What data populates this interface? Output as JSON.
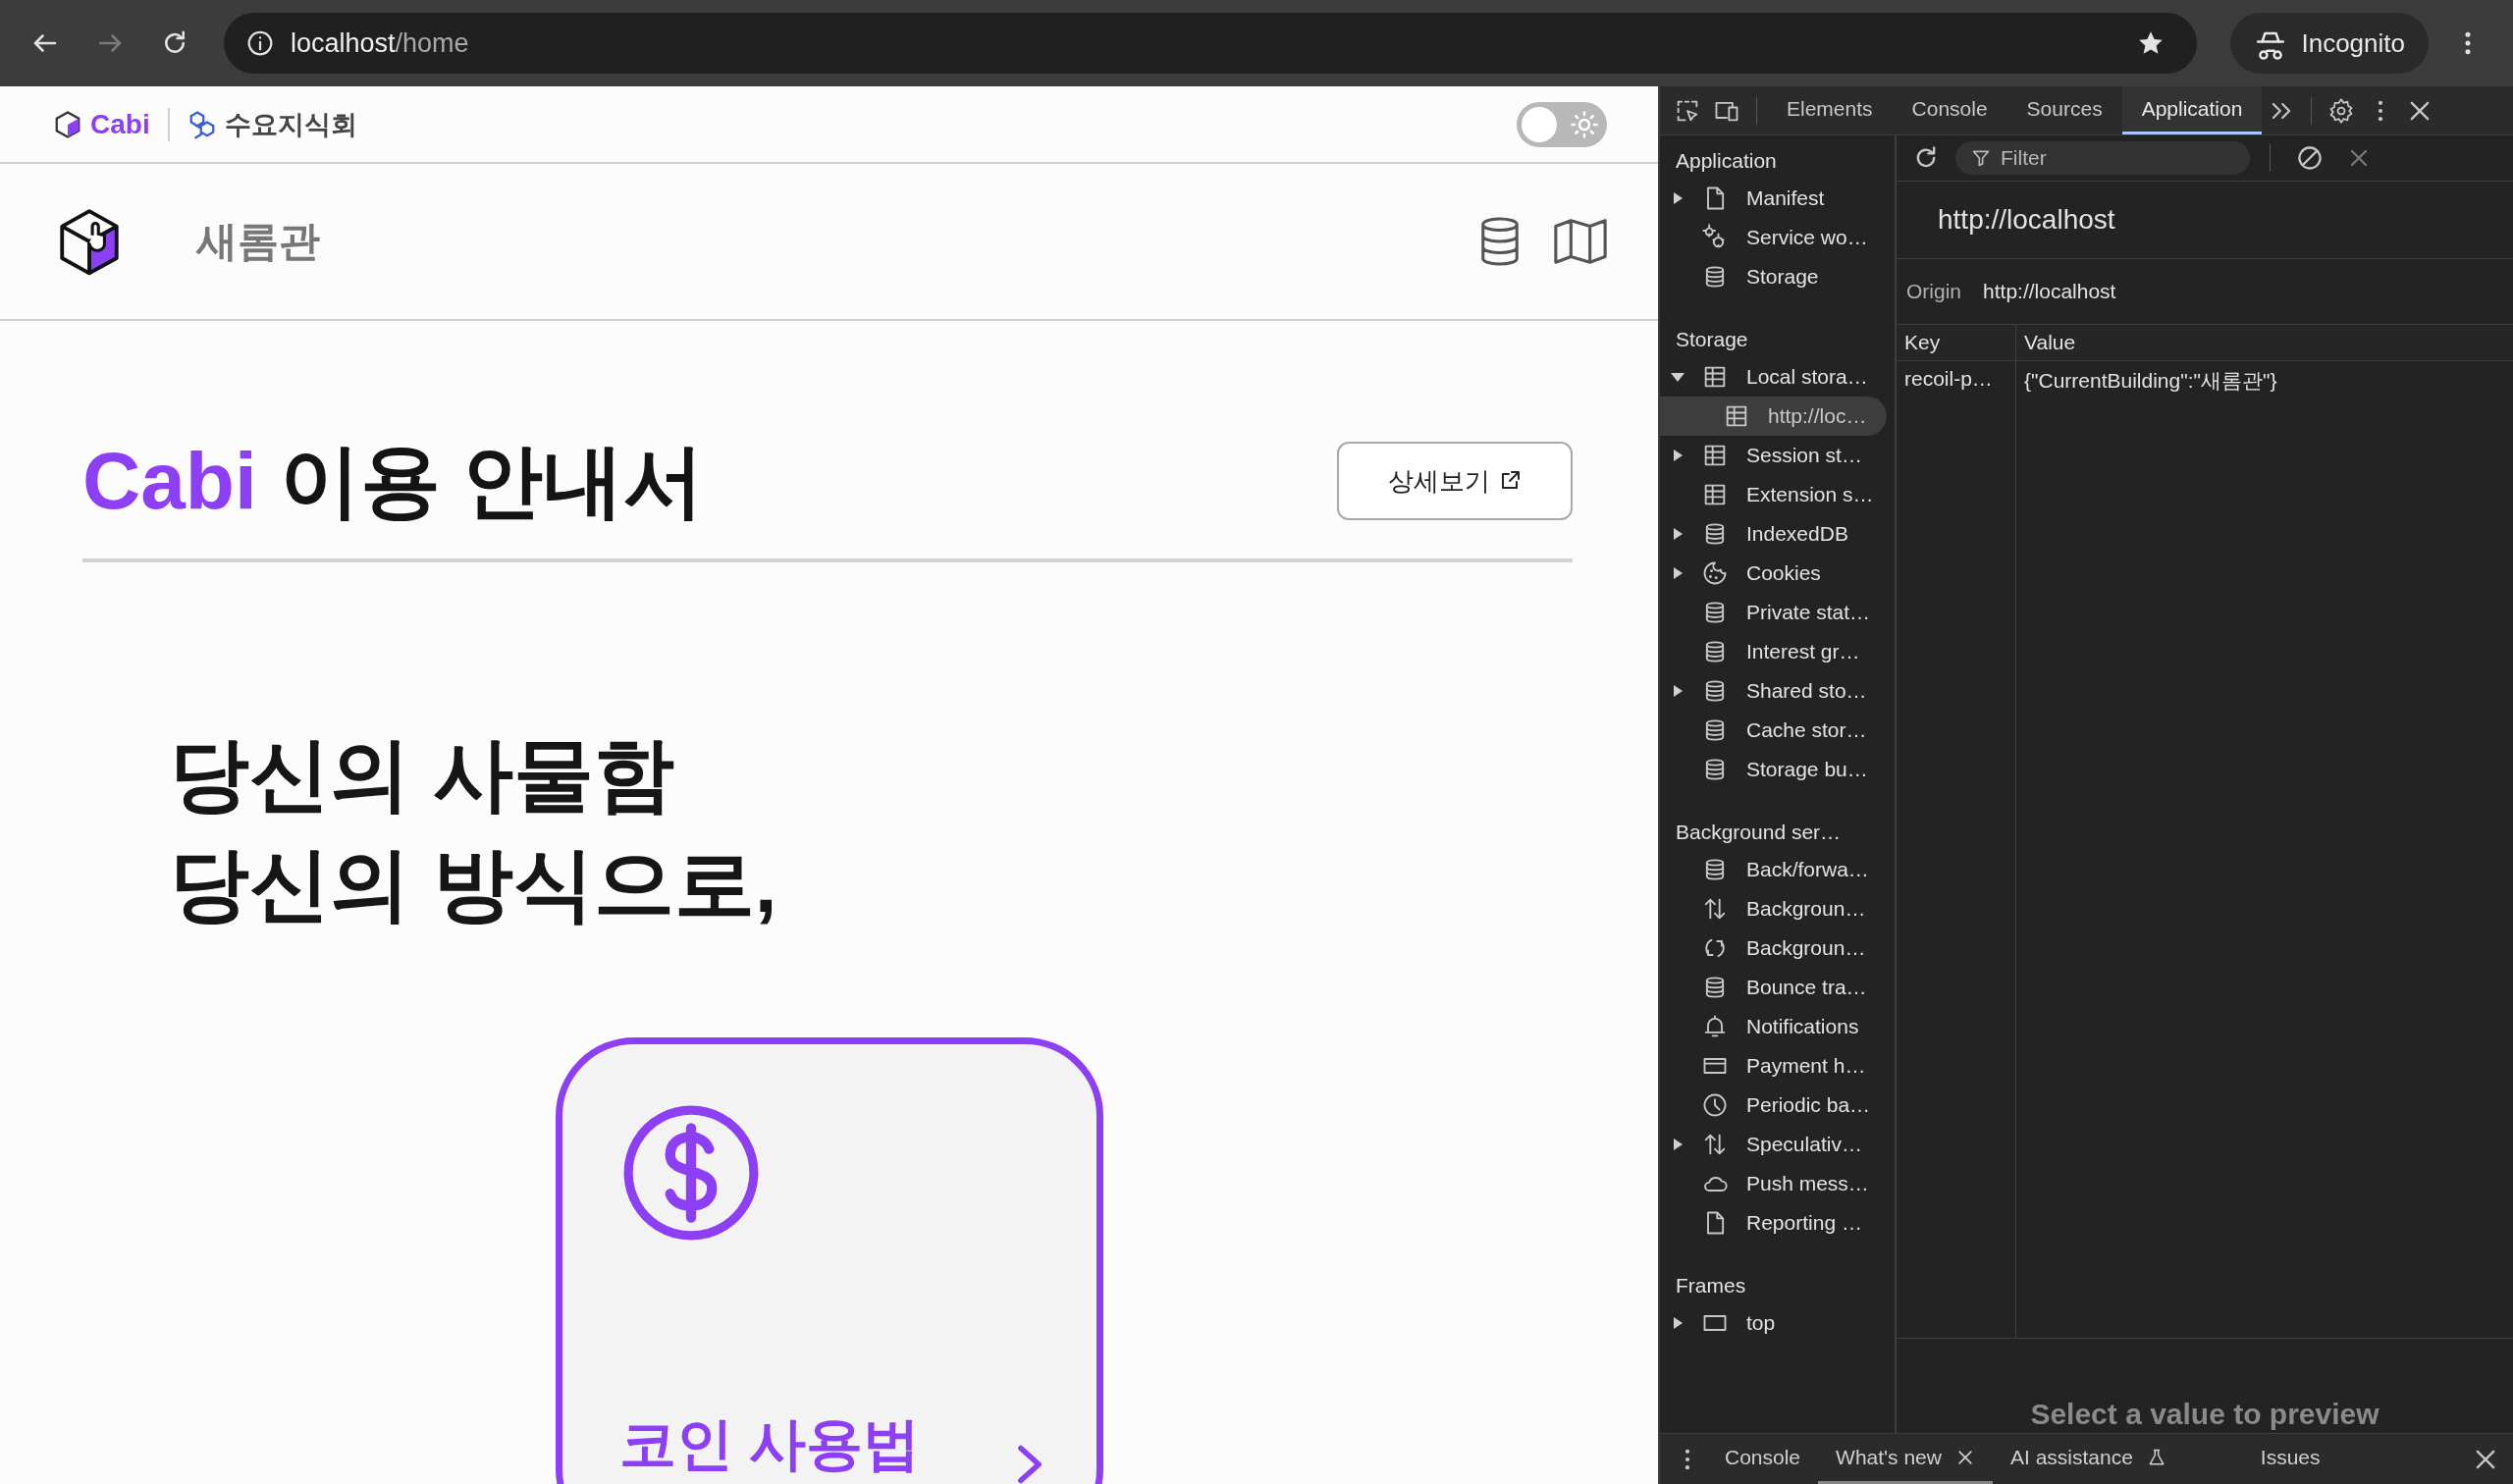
{
  "browser": {
    "forward_disabled": true,
    "url_host": "localhost",
    "url_path": "/home",
    "profile": "Incognito"
  },
  "site": {
    "topbar": {
      "brand": "Cabi",
      "club": "수요지식회",
      "dark_mode": {
        "on": false
      }
    },
    "building": "새롬관",
    "guide": {
      "brand": "Cabi",
      "title": "이용 안내서",
      "details_button": "상세보기"
    },
    "headline": [
      "당신의 사물함",
      "당신의 방식으로,"
    ],
    "card": {
      "title": "코인 사용법"
    }
  },
  "devtools": {
    "tabs": [
      {
        "label": "Elements",
        "selected": false
      },
      {
        "label": "Console",
        "selected": false
      },
      {
        "label": "Sources",
        "selected": false
      },
      {
        "label": "Application",
        "selected": true
      }
    ],
    "sidebar": [
      {
        "heading": "Application",
        "items": [
          {
            "label": "Manifest",
            "kind": "file",
            "expandable": true,
            "expanded": false,
            "selected": false
          },
          {
            "label": "Service wo…",
            "kind": "gears",
            "expandable": false,
            "selected": false
          },
          {
            "label": "Storage",
            "kind": "database",
            "expandable": false,
            "selected": false
          }
        ]
      },
      {
        "heading": "Storage",
        "items": [
          {
            "label": "Local stora…",
            "kind": "table",
            "expandable": true,
            "expanded": true,
            "selected": false,
            "children": [
              {
                "label": "http://loc…",
                "kind": "table",
                "expandable": false,
                "selected": true
              }
            ]
          },
          {
            "label": "Session st…",
            "kind": "table",
            "expandable": true,
            "expanded": false,
            "selected": false
          },
          {
            "label": "Extension s…",
            "kind": "table",
            "expandable": false,
            "selected": false
          },
          {
            "label": "IndexedDB",
            "kind": "database",
            "expandable": true,
            "expanded": false,
            "selected": false
          },
          {
            "label": "Cookies",
            "kind": "cookie",
            "expandable": true,
            "expanded": false,
            "selected": false
          },
          {
            "label": "Private stat…",
            "kind": "database",
            "expandable": false,
            "selected": false
          },
          {
            "label": "Interest gr…",
            "kind": "database",
            "expandable": false,
            "selected": false
          },
          {
            "label": "Shared sto…",
            "kind": "database",
            "expandable": true,
            "expanded": false,
            "selected": false
          },
          {
            "label": "Cache stor…",
            "kind": "database",
            "expandable": false,
            "selected": false
          },
          {
            "label": "Storage bu…",
            "kind": "database",
            "expandable": false,
            "selected": false
          }
        ]
      },
      {
        "heading": "Background ser…",
        "items": [
          {
            "label": "Back/forwa…",
            "kind": "database",
            "expandable": false,
            "selected": false
          },
          {
            "label": "Backgroun…",
            "kind": "updown",
            "expandable": false,
            "selected": false
          },
          {
            "label": "Backgroun…",
            "kind": "sync",
            "expandable": false,
            "selected": false
          },
          {
            "label": "Bounce tra…",
            "kind": "database",
            "expandable": false,
            "selected": false
          },
          {
            "label": "Notifications",
            "kind": "bell",
            "expandable": false,
            "selected": false
          },
          {
            "label": "Payment h…",
            "kind": "card",
            "expandable": false,
            "selected": false
          },
          {
            "label": "Periodic ba…",
            "kind": "clock",
            "expandable": false,
            "selected": false
          },
          {
            "label": "Speculativ…",
            "kind": "updown",
            "expandable": true,
            "expanded": false,
            "selected": false
          },
          {
            "label": "Push mess…",
            "kind": "cloud",
            "expandable": false,
            "selected": false
          },
          {
            "label": "Reporting …",
            "kind": "file",
            "expandable": false,
            "selected": false
          }
        ]
      },
      {
        "heading": "Frames",
        "items": [
          {
            "label": "top",
            "kind": "frame",
            "expandable": true,
            "expanded": false,
            "selected": false
          }
        ]
      }
    ],
    "filter_placeholder": "Filter",
    "origin_title": "http://localhost",
    "origin_label": "Origin",
    "origin_value": "http://localhost",
    "table": {
      "columns": [
        "Key",
        "Value"
      ],
      "rows": [
        {
          "cells": [
            "recoil-p…",
            "{\"CurrentBuilding\":\"새롬관\"}"
          ]
        }
      ]
    },
    "preview_hint": "Select a value to preview",
    "drawer_tabs": [
      {
        "label": "Console",
        "selected": false,
        "kind": "plain"
      },
      {
        "label": "What's new",
        "selected": true,
        "kind": "closable"
      },
      {
        "label": "AI assistance",
        "selected": false,
        "kind": "experimental"
      },
      {
        "label": "Issues",
        "selected": false,
        "kind": "plain"
      }
    ]
  }
}
